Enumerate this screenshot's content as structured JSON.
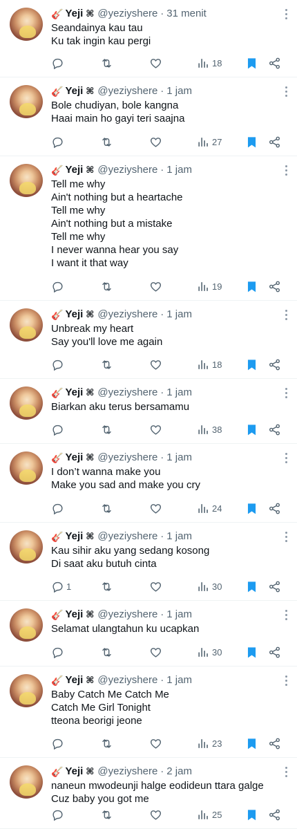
{
  "user": {
    "name": "Yeji",
    "badge": "🎸",
    "cmd": "⌘",
    "handle": "@yeziyshere",
    "separator": "·"
  },
  "tweets": [
    {
      "time": "31 menit",
      "lines": [
        "Seandainya kau tau",
        "Ku tak ingin kau pergi"
      ],
      "replies": "",
      "views": "18"
    },
    {
      "time": "1 jam",
      "lines": [
        "Bole chudiyan, bole kangna",
        "Haai main ho gayi teri saajna"
      ],
      "replies": "",
      "views": "27"
    },
    {
      "time": "1 jam",
      "lines": [
        "Tell me why",
        "Ain't nothing but a heartache",
        "Tell me why",
        "Ain't nothing but a mistake",
        "Tell me why",
        "I never wanna hear you say",
        "I want it that way"
      ],
      "replies": "",
      "views": "19"
    },
    {
      "time": "1 jam",
      "lines": [
        "Unbreak my heart",
        "Say you'll love me again"
      ],
      "replies": "",
      "views": "18"
    },
    {
      "time": "1 jam",
      "lines": [
        "Biarkan aku terus bersamamu"
      ],
      "replies": "",
      "views": "38"
    },
    {
      "time": "1 jam",
      "lines": [
        "I don’t wanna make you",
        "Make you sad and make you cry"
      ],
      "replies": "",
      "views": "24"
    },
    {
      "time": "1 jam",
      "lines": [
        "Kau sihir aku yang sedang kosong",
        "Di saat aku butuh cinta"
      ],
      "replies": "1",
      "views": "30"
    },
    {
      "time": "1 jam",
      "lines": [
        "Selamat ulangtahun ku ucapkan"
      ],
      "replies": "",
      "views": "30"
    },
    {
      "time": "1 jam",
      "lines": [
        "Baby Catch Me Catch Me",
        "Catch Me Girl Tonight",
        "tteona beorigi jeone"
      ],
      "replies": "",
      "views": "23"
    },
    {
      "time": "2 jam",
      "lines": [
        "naneun mwodeunji halge eodideun ttara galge",
        "Cuz baby you got me"
      ],
      "replies": "",
      "views": "25"
    }
  ],
  "icons": {
    "reply": "reply-icon",
    "retweet": "retweet-icon",
    "like": "heart-icon",
    "views": "views-icon",
    "bookmark": "bookmark-icon",
    "share": "share-icon",
    "more": "more-icon"
  },
  "colors": {
    "bookmark": "#1d9bf0",
    "text": "#0f1419",
    "secondary": "#536471",
    "divider": "#eff3f4"
  }
}
